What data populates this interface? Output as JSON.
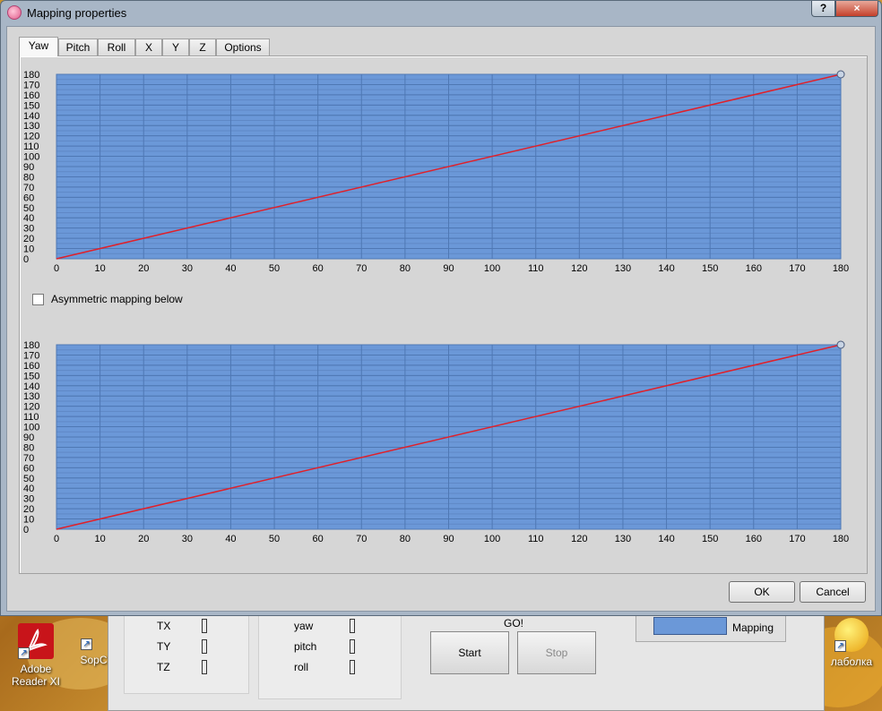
{
  "dialog": {
    "title": "Mapping properties",
    "help_label": "?",
    "close_label": "×",
    "tabs": [
      {
        "label": "Yaw",
        "active": true
      },
      {
        "label": "Pitch"
      },
      {
        "label": "Roll"
      },
      {
        "label": "X"
      },
      {
        "label": "Y"
      },
      {
        "label": "Z"
      },
      {
        "label": "Options"
      }
    ],
    "asymmetric_label": "Asymmetric mapping below",
    "asymmetric_checked": false,
    "ok_label": "OK",
    "cancel_label": "Cancel"
  },
  "chart_data": [
    {
      "type": "line",
      "x": [
        0,
        180
      ],
      "series": [
        {
          "values": [
            0,
            180
          ],
          "color": "#e0202a"
        }
      ],
      "xlim": [
        0,
        180
      ],
      "ylim": [
        0,
        180
      ],
      "xticks": [
        0,
        10,
        20,
        30,
        40,
        50,
        60,
        70,
        80,
        90,
        100,
        110,
        120,
        130,
        140,
        150,
        160,
        170,
        180
      ],
      "yticks": [
        0,
        10,
        20,
        30,
        40,
        50,
        60,
        70,
        80,
        90,
        100,
        110,
        120,
        130,
        140,
        150,
        160,
        170,
        180
      ],
      "grid": true,
      "control_point": [
        180,
        180
      ],
      "background": "#6b98d8"
    },
    {
      "type": "line",
      "x": [
        0,
        180
      ],
      "series": [
        {
          "values": [
            0,
            180
          ],
          "color": "#e0202a"
        }
      ],
      "xlim": [
        0,
        180
      ],
      "ylim": [
        0,
        180
      ],
      "xticks": [
        0,
        10,
        20,
        30,
        40,
        50,
        60,
        70,
        80,
        90,
        100,
        110,
        120,
        130,
        140,
        150,
        160,
        170,
        180
      ],
      "yticks": [
        0,
        10,
        20,
        30,
        40,
        50,
        60,
        70,
        80,
        90,
        100,
        110,
        120,
        130,
        140,
        150,
        160,
        170,
        180
      ],
      "grid": true,
      "control_point": [
        180,
        180
      ],
      "background": "#6b98d8"
    }
  ],
  "background_app": {
    "translation_labels": [
      "TX",
      "TY",
      "TZ"
    ],
    "rotation_labels": [
      "yaw",
      "pitch",
      "roll"
    ],
    "go_label": "GO!",
    "start_label": "Start",
    "stop_label": "Stop",
    "mapping_label": "Mapping"
  },
  "desktop": {
    "icons": [
      {
        "label": "Adobe Reader XI"
      },
      {
        "label": "SopC"
      },
      {
        "label": "лаболка"
      }
    ]
  }
}
